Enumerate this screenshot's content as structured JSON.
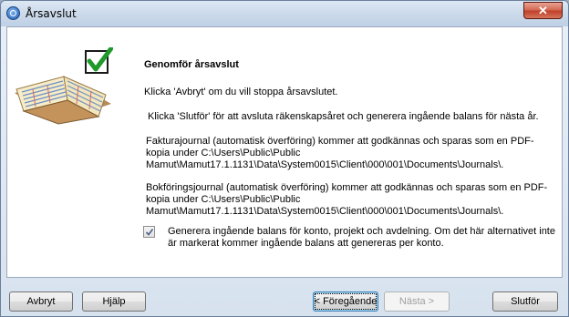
{
  "window": {
    "title": "Årsavslut",
    "close_glyph": "✕"
  },
  "content": {
    "heading": "Genomför årsavslut",
    "p1": "Klicka 'Avbryt' om du vill stoppa årsavslutet.",
    "p2": "Klicka 'Slutför' för att avsluta räkenskapsåret och generera ingående balans för nästa år.",
    "p3": "Fakturajournal (automatisk överföring) kommer att godkännas och sparas som en PDF-kopia under C:\\Users\\Public\\Public Mamut\\Mamut17.1.1131\\Data\\System0015\\Client\\000\\001\\Documents\\Journals\\.",
    "p4": "Bokföringsjournal (automatisk överföring) kommer att godkännas och sparas som en PDF-kopia under C:\\Users\\Public\\Public Mamut\\Mamut17.1.1131\\Data\\System0015\\Client\\000\\001\\Documents\\Journals\\.",
    "checkbox_checked": true,
    "checkbox_label": "Generera ingående balans för konto, projekt och avdelning. Om det här alternativet inte är markerat kommer ingående balans att genereras per konto."
  },
  "buttons": {
    "cancel": "Avbryt",
    "help": "Hjälp",
    "previous": "< Föregående",
    "next": "Nästa >",
    "finish": "Slutför"
  },
  "icons": {
    "app": "mamut-app-icon",
    "illustration": "ledger-book-icon",
    "check": "checkmark-icon"
  }
}
